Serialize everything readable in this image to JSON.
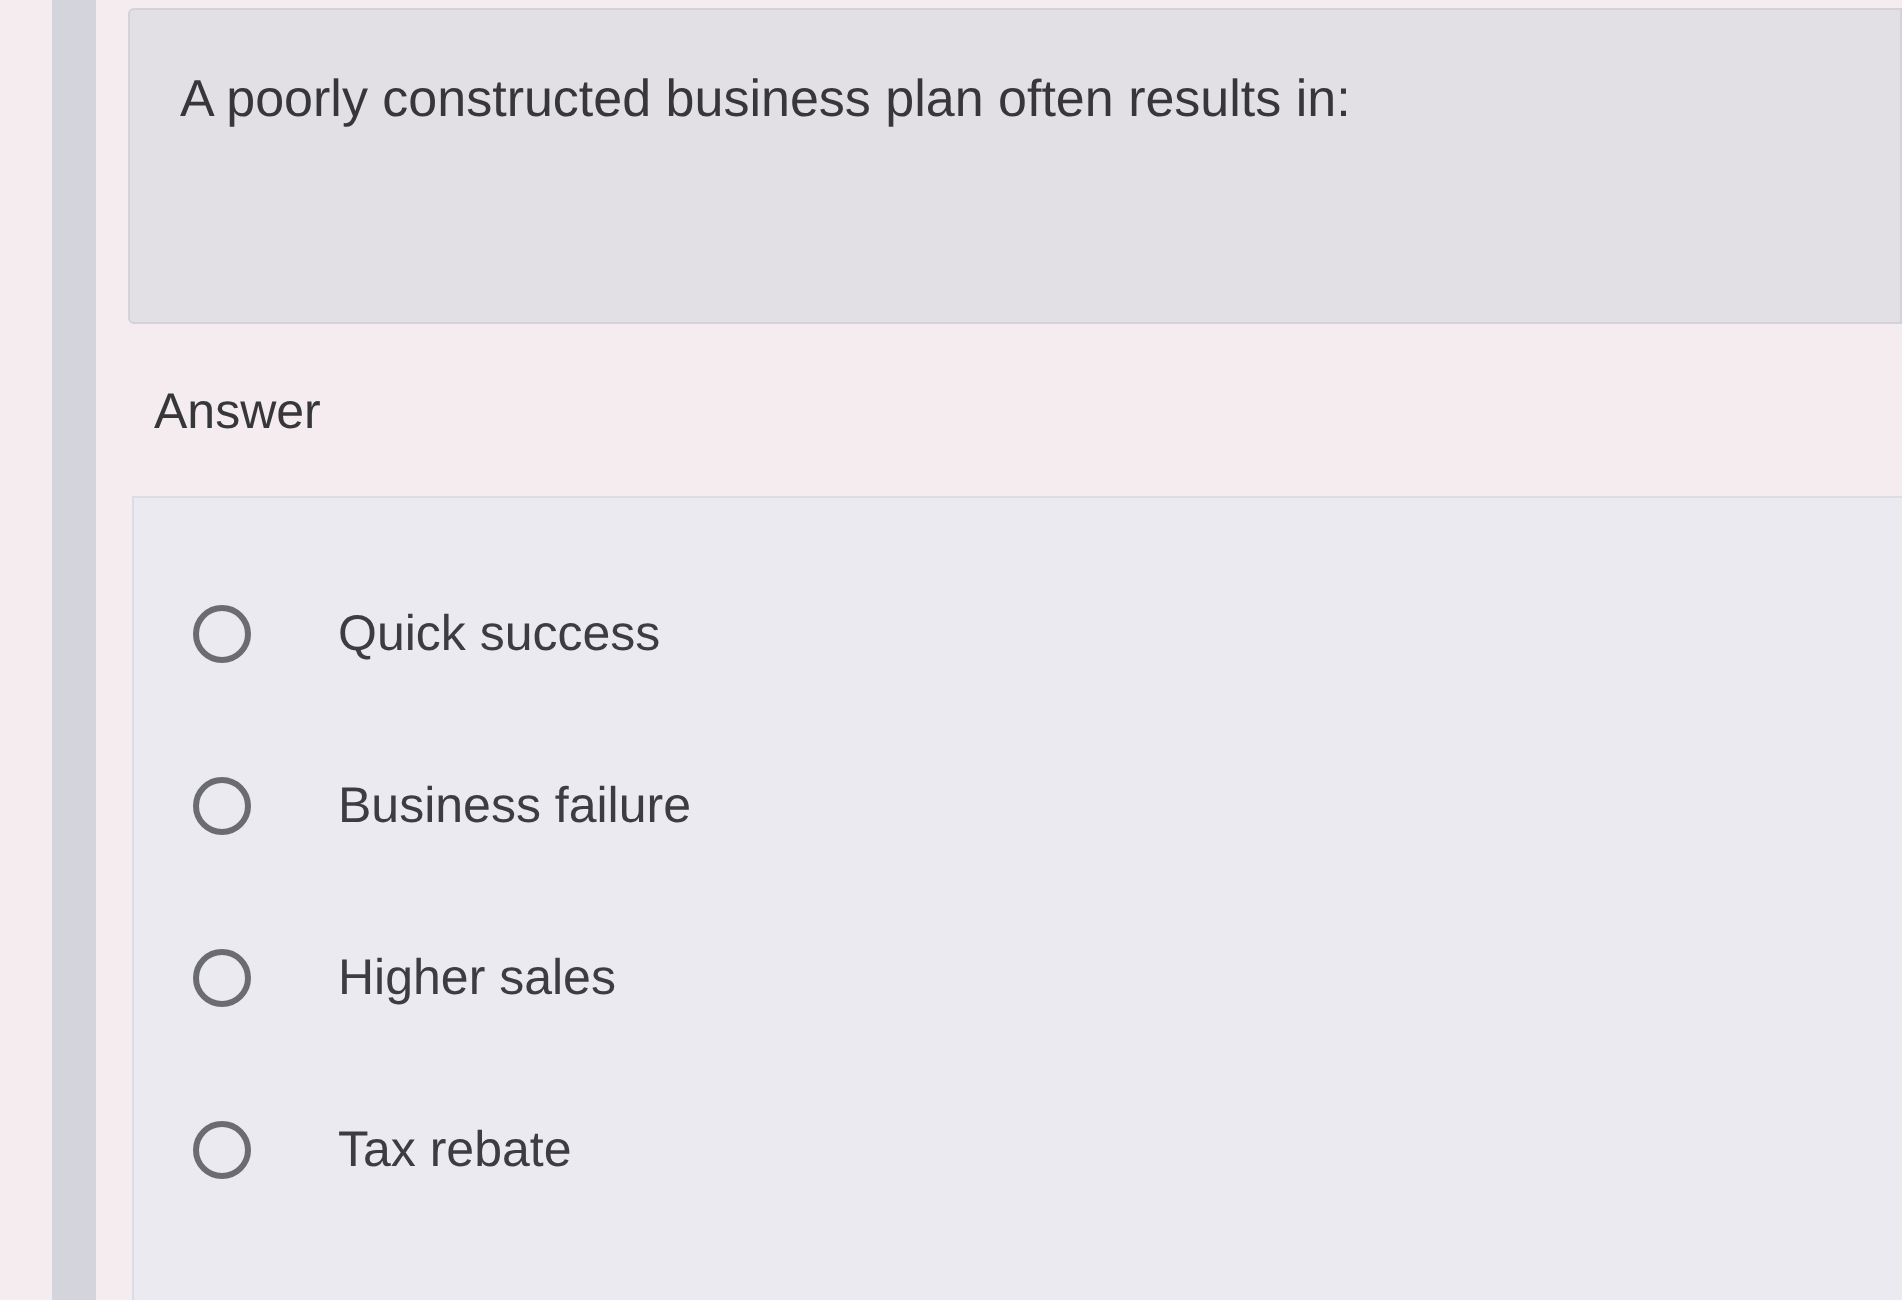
{
  "question": {
    "text": "A poorly constructed business plan often results in:"
  },
  "answer_label": "Answer",
  "options": [
    {
      "label": "Quick success",
      "selected": false
    },
    {
      "label": "Business failure",
      "selected": false
    },
    {
      "label": "Higher sales",
      "selected": false
    },
    {
      "label": "Tax rebate",
      "selected": false
    }
  ]
}
